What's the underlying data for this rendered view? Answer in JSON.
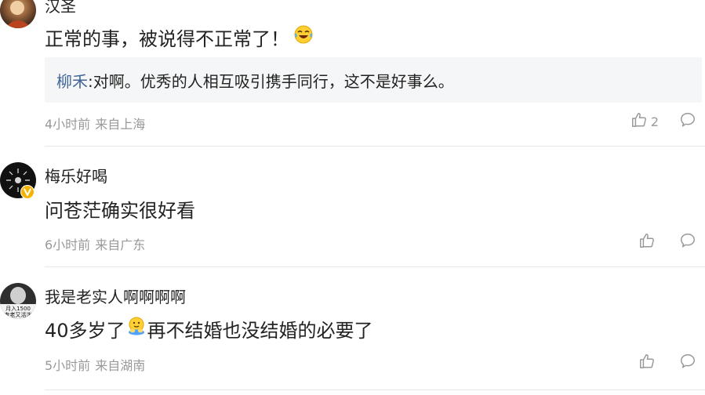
{
  "comments": [
    {
      "username": "汉圣",
      "content": "正常的事，被说得不正常了！",
      "content_emoji": "laughing-tears-emoji",
      "reply": {
        "author": "柳禾",
        "text": ":对啊。优秀的人相互吸引携手同行，这不是好事么。"
      },
      "time": "4小时前",
      "location": "来自上海",
      "likes": "2"
    },
    {
      "username": "梅乐好喝",
      "content": "问苍茫确实很好看",
      "time": "6小时前",
      "location": "来自广东",
      "likes": ""
    },
    {
      "username": "我是老实人啊啊啊啊",
      "avatar_text": "月入1500\n专老又活泼",
      "content_prefix": "40多岁了",
      "content_emoji": "hands-face-emoji",
      "content_suffix": "再不结婚也没结婚的必要了",
      "time": "5小时前",
      "location": "来自湖南",
      "likes": ""
    }
  ],
  "colors": {
    "reply_author": "#406599",
    "meta_text": "#999999",
    "reply_bg": "#f5f6f7",
    "verified_badge": "#f5b400"
  },
  "icons": {
    "like": "thumbs-up-icon",
    "reply": "speech-bubble-icon",
    "verified": "verified-v-badge"
  }
}
